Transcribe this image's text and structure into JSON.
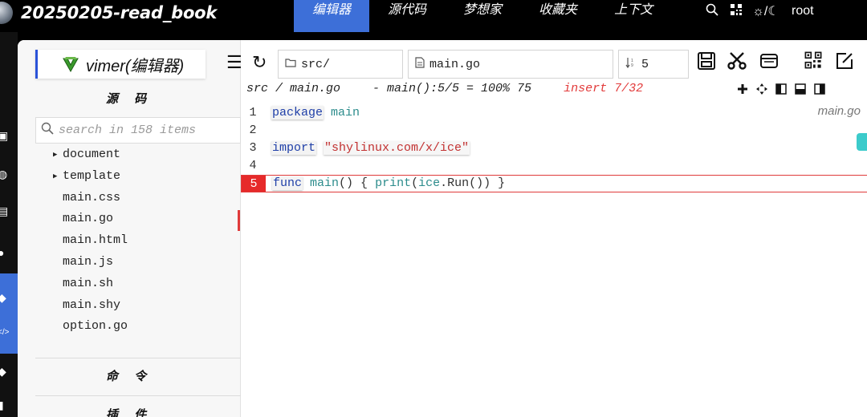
{
  "app": {
    "title": "20250205-read_book"
  },
  "menu": [
    {
      "label": "编辑器",
      "active": true
    },
    {
      "label": "源代码"
    },
    {
      "label": "梦想家"
    },
    {
      "label": "收藏夹"
    },
    {
      "label": "上下文"
    }
  ],
  "topbar": {
    "theme_label": "☼/☾",
    "user": "root"
  },
  "sidebar": {
    "logo_text": "vimer(编辑器)",
    "section_source": "源 码",
    "search_placeholder": "search in 158 items",
    "items": [
      {
        "label": "document",
        "folder": true
      },
      {
        "label": "template",
        "folder": true
      },
      {
        "label": "main.css"
      },
      {
        "label": "main.go",
        "selected": true
      },
      {
        "label": "main.html"
      },
      {
        "label": "main.js"
      },
      {
        "label": "main.sh"
      },
      {
        "label": "main.shy"
      },
      {
        "label": "option.go"
      }
    ],
    "section_command": "命 令",
    "section_plugin": "插 件"
  },
  "toolbar": {
    "menu_glyph": "☰",
    "refresh_glyph": "↻",
    "path": "src/",
    "file": "main.go",
    "line": "5"
  },
  "status": {
    "path": "src / main.go",
    "position": "- main():5/5 = 100% 75",
    "mode": "insert 7/32"
  },
  "editor": {
    "file_tag": "main.go",
    "lines": [
      {
        "n": "1"
      },
      {
        "n": "2"
      },
      {
        "n": "3"
      },
      {
        "n": "4"
      },
      {
        "n": "5"
      }
    ],
    "tokens": {
      "l1_kw": "package",
      "l1_id": "main",
      "l3_kw": "import",
      "l3_str": "\"shylinux.com/x/ice\"",
      "l5_kw": "func",
      "l5_id1": "main",
      "l5_p1": "() { ",
      "l5_id2": "print",
      "l5_p2": "(",
      "l5_id3": "ice",
      "l5_p3": ".Run()) }"
    }
  }
}
